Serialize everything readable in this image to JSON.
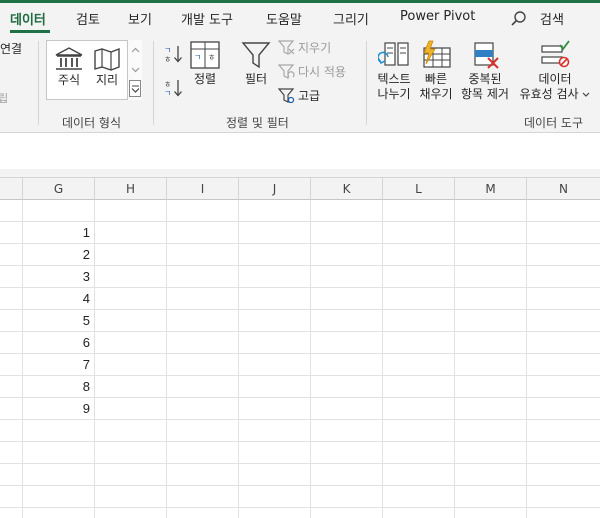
{
  "tabs": [
    {
      "label": "데이터",
      "active": true
    },
    {
      "label": "검토"
    },
    {
      "label": "보기"
    },
    {
      "label": "개발 도구"
    },
    {
      "label": "도움말"
    },
    {
      "label": "그리기"
    },
    {
      "label": "Power Pivot"
    }
  ],
  "search_label": "검색",
  "ribbon": {
    "left_cut_label": "연결",
    "left_cut_gray": "립",
    "data_types": {
      "stocks": "주식",
      "geography": "지리",
      "group": "데이터 형식"
    },
    "sort_filter": {
      "sort": "정렬",
      "filter": "필터",
      "clear": "지우기",
      "reapply": "다시 적용",
      "advanced": "고급",
      "group": "정렬 및 필터"
    },
    "data_tools": {
      "text_to_columns_1": "텍스트",
      "text_to_columns_2": "나누기",
      "flash_fill_1": "빠른",
      "flash_fill_2": "채우기",
      "remove_dup_1": "중복된",
      "remove_dup_2": "항목 제거",
      "validation_1": "데이터",
      "validation_2": "유효성 검사",
      "group": "데이터 도구"
    }
  },
  "columns": [
    "G",
    "H",
    "I",
    "J",
    "K",
    "L",
    "M",
    "N"
  ],
  "cells_g": [
    "",
    "1",
    "2",
    "3",
    "4",
    "5",
    "6",
    "7",
    "8",
    "9",
    "",
    "",
    "",
    "",
    ""
  ],
  "colors": {
    "accent": "#1e7145",
    "ribbon_bg": "#f3f3f3",
    "grid_line": "#e1e1e1"
  }
}
